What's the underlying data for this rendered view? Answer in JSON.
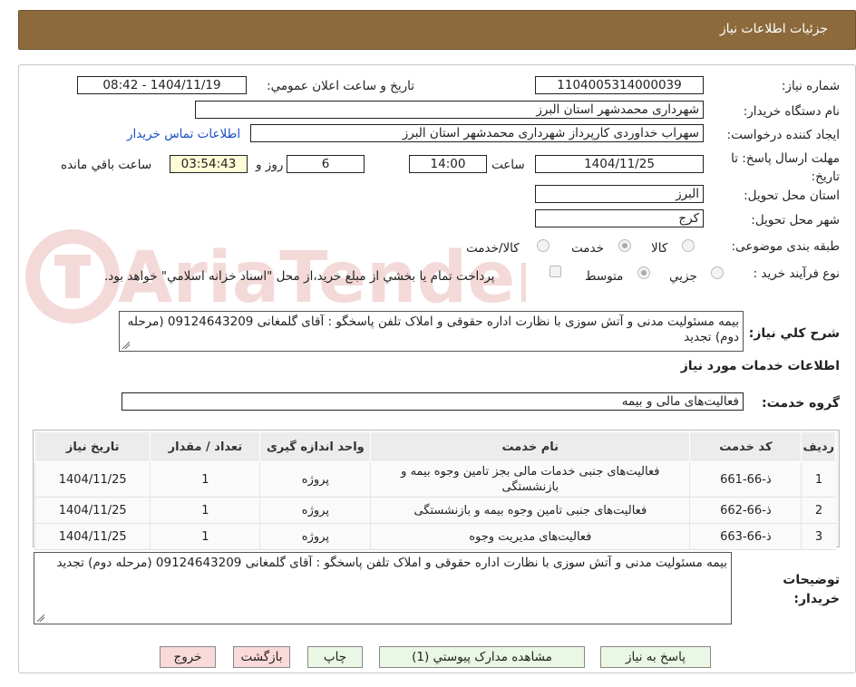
{
  "header": {
    "title": "جزئيات اطلاعات نياز"
  },
  "form": {
    "need_number_label": "شماره نياز:",
    "need_number": "1104005314000039",
    "announce_label": "تاريخ و ساعت اعلان عمومي:",
    "announce_value": "1404/11/19 - 08:42",
    "buyer_org_label": "نام دستگاه خريدار:",
    "buyer_org": "شهرداری محمدشهر استان البرز",
    "requester_label": "ايجاد كننده درخواست:",
    "requester": "سهراب خداوردی کارپرداز شهرداری محمدشهر استان البرز",
    "contact_link": "اطلاعات تماس خريدار",
    "deadline_label": "مهلت ارسال پاسخ: تا تاريخ:",
    "deadline_date": "1404/11/25",
    "time_label": "ساعت",
    "deadline_time": "14:00",
    "days_value": "6",
    "days_label": "روز و",
    "remaining_time": "03:54:43",
    "remaining_label": "ساعت باقي مانده",
    "province_label": "استان محل تحويل:",
    "province": "البرز",
    "city_label": "شهر محل تحويل:",
    "city": "کرج",
    "category_label": "طبقه بندی موضوعی:",
    "category_options": [
      "كالا",
      "خدمت",
      "كالا/خدمت"
    ],
    "category_selected": "خدمت",
    "process_label": "نوع فرآيند خريد :",
    "process_options": [
      "جزيي",
      "متوسط"
    ],
    "process_selected": "متوسط",
    "payment_note": "پرداخت تمام يا بخشي از مبلغ خريد،از محل \"اسناد خزانه اسلامي\" خواهد بود."
  },
  "summary": {
    "label": "شرح كلي نياز:",
    "text": "بیمه مسئولیت مدنی و آتش سوزی با نظارت اداره حقوقی و املاک تلفن پاسخگو : آقای گلمغانی 09124643209 (مرحله دوم) تجدید"
  },
  "services": {
    "section_title": "اطلاعات خدمات مورد نياز",
    "group_label": "گروه خدمت:",
    "group_value": "فعاليت‌های مالی و بيمه",
    "columns": [
      "رديف",
      "كد خدمت",
      "نام خدمت",
      "واحد اندازه گيری",
      "تعداد / مقدار",
      "تاريخ نياز"
    ],
    "rows": [
      [
        "1",
        "ذ-66-661",
        "فعاليت‌های جنبی خدمات مالی بجز تامين وجوه بيمه و بازنشستگی",
        "پروژه",
        "1",
        "1404/11/25"
      ],
      [
        "2",
        "ذ-66-662",
        "فعاليت‌های جنبی تامين وجوه بيمه و بازنشستگی",
        "پروژه",
        "1",
        "1404/11/25"
      ],
      [
        "3",
        "ذ-66-663",
        "فعاليت‌های مديريت وجوه",
        "پروژه",
        "1",
        "1404/11/25"
      ]
    ]
  },
  "buyer_notes": {
    "label": "توضيحات خريدار:",
    "text": "بیمه مسئولیت مدنی و آتش سوزی با نظارت اداره حقوقی و املاک تلفن پاسخگو : آقای گلمغانی 09124643209 (مرحله دوم) تجدید"
  },
  "buttons": {
    "reply": "پاسخ به نياز",
    "attachments": "مشاهده مدارک پيوستي (1)",
    "print": "چاپ",
    "back": "بازگشت",
    "exit": "خروج"
  },
  "watermark": {
    "text": "AriaTender.neT"
  }
}
